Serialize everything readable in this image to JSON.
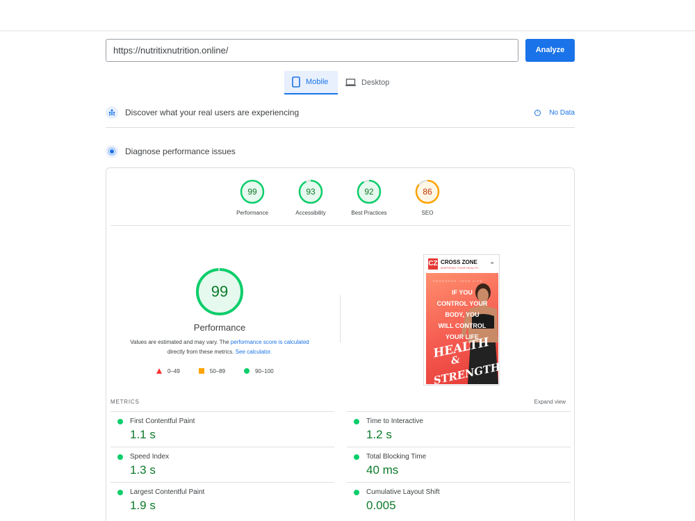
{
  "search": {
    "url": "https://nutritixnutrition.online/",
    "analyze_label": "Analyze"
  },
  "tabs": [
    {
      "label": "Mobile",
      "active": true
    },
    {
      "label": "Desktop",
      "active": false
    }
  ],
  "field_data": {
    "title": "Discover what your real users are experiencing",
    "status": "No Data"
  },
  "lab": {
    "title": "Diagnose performance issues"
  },
  "scores": [
    {
      "label": "Performance",
      "value": "99",
      "rating": "good"
    },
    {
      "label": "Accessibility",
      "value": "93",
      "rating": "good"
    },
    {
      "label": "Best Practices",
      "value": "92",
      "rating": "good"
    },
    {
      "label": "SEO",
      "value": "86",
      "rating": "average"
    }
  ],
  "main_score": {
    "value": "99",
    "label": "Performance",
    "note_prefix": "Values are estimated and may vary. The ",
    "note_link": "performance score is calculated",
    "note_mid": "directly from these metrics. ",
    "note_link2": "See calculator."
  },
  "legend": [
    {
      "range": "0–49",
      "color": "#ff3333"
    },
    {
      "range": "50–89",
      "color": "#ffa400"
    },
    {
      "range": "90–100",
      "color": "#0cce6b"
    }
  ],
  "screenshot": {
    "brand": "CROSS ZONE",
    "tagline": "INSPIRING YOUR HEALTH",
    "logo": "CZ",
    "kicker": "PROGRESS YOUR LIFE",
    "headline": [
      "IF YOU",
      "CONTROL YOUR",
      "BODY, YOU",
      "WILL CONTROL",
      "YOUR LIFE"
    ],
    "script1": "HEALTH",
    "script2": "&",
    "script3": "STRENGTH"
  },
  "metrics": {
    "label": "METRICS",
    "expand_label": "Expand view",
    "items": [
      {
        "name": "First Contentful Paint",
        "value": "1.1 s"
      },
      {
        "name": "Time to Interactive",
        "value": "1.2 s"
      },
      {
        "name": "Speed Index",
        "value": "1.3 s"
      },
      {
        "name": "Total Blocking Time",
        "value": "40 ms"
      },
      {
        "name": "Largest Contentful Paint",
        "value": "1.9 s"
      },
      {
        "name": "Cumulative Layout Shift",
        "value": "0.005"
      }
    ]
  },
  "colors": {
    "accent": "#1a73e8",
    "good": "#0cce6b",
    "good_text": "#0c7a2a",
    "average": "#ffa400",
    "average_text": "#c33300",
    "poor": "#ff3333"
  }
}
